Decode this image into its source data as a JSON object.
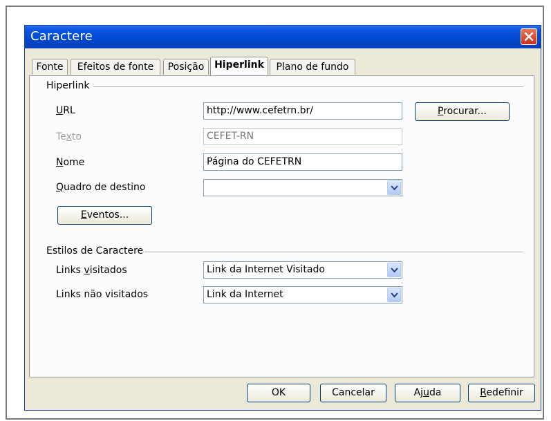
{
  "window": {
    "title": "Caractere"
  },
  "tabs": [
    {
      "label": "Fonte"
    },
    {
      "label": "Efeitos de fonte"
    },
    {
      "label": "Posição"
    },
    {
      "label": "Hiperlink"
    },
    {
      "label": "Plano de fundo"
    }
  ],
  "hyperlink_group": {
    "label": "Hiperlink",
    "url_label": "URL",
    "url_value": "http://www.cefetrn.br/",
    "browse_button": "Procurar...",
    "text_label": "Texto",
    "text_value": "CEFET-RN",
    "name_label": "Nome",
    "name_value": "Página do CEFETRN",
    "target_label": "Quadro de destino",
    "target_value": "",
    "events_button": "Eventos..."
  },
  "styles_group": {
    "label": "Estilos de Caractere",
    "visited_label": "Links visitados",
    "visited_value": "Link da Internet Visitado",
    "unvisited_label": "Links não visitados",
    "unvisited_value": "Link da Internet"
  },
  "footer": {
    "ok": "OK",
    "cancel": "Cancelar",
    "help": "Ajuda",
    "reset": "Redefinir"
  },
  "colors": {
    "titlebar": "#0248d0",
    "close_button": "#c8301a",
    "dialog_bg": "#ece9d8"
  },
  "icons": {
    "close": "close-icon",
    "dropdown": "chevron-down-icon"
  }
}
